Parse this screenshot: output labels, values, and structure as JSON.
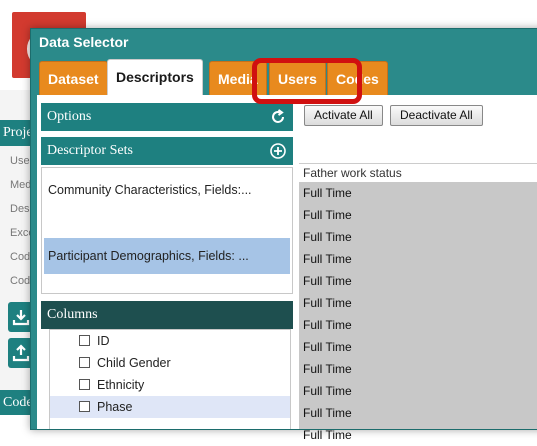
{
  "dialog": {
    "title": "Data Selector",
    "tabs": [
      {
        "label": "Dataset",
        "active": false
      },
      {
        "label": "Descriptors",
        "active": true
      },
      {
        "label": "Media",
        "active": false
      },
      {
        "label": "Users",
        "active": false
      },
      {
        "label": "Codes",
        "active": false
      }
    ]
  },
  "options": {
    "title": "Options",
    "refresh_icon": "refresh-icon"
  },
  "descriptor_sets": {
    "title": "Descriptor Sets",
    "add_icon": "plus-circle-icon",
    "items": [
      {
        "label": "Community Characteristics, Fields:...",
        "selected": false
      },
      {
        "label": "Participant Demographics, Fields: ...",
        "selected": true
      }
    ]
  },
  "columns": {
    "title": "Columns",
    "items": [
      {
        "label": "ID",
        "checked": false
      },
      {
        "label": "Child Gender",
        "checked": false
      },
      {
        "label": "Ethnicity",
        "checked": false
      },
      {
        "label": "Phase",
        "checked": false,
        "highlighted": true
      }
    ]
  },
  "toolbar": {
    "activate_all": "Activate All",
    "deactivate_all": "Deactivate All"
  },
  "grid": {
    "header": "Father work status",
    "rows": [
      "Full Time",
      "Full Time",
      "Full Time",
      "Full Time",
      "Full Time",
      "Full Time",
      "Full Time",
      "Full Time",
      "Full Time",
      "Full Time",
      "Full Time",
      "Full Time"
    ]
  },
  "background": {
    "projects_label": "Proje",
    "codes_label": "Code",
    "items": [
      "User",
      "Medi",
      "Desc",
      "Excer",
      "Code",
      "Code"
    ]
  }
}
